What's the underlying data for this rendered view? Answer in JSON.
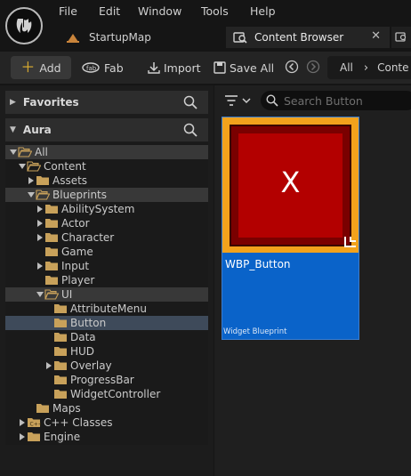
{
  "menu": [
    "File",
    "Edit",
    "Window",
    "Tools",
    "Help"
  ],
  "tabs": {
    "map": "StartupMap",
    "browser": "Content Browser"
  },
  "toolbar": {
    "add": "Add",
    "fab": "Fab",
    "import": "Import",
    "save_all": "Save All"
  },
  "breadcrumbs": {
    "first": "All",
    "second": "Conte"
  },
  "panels": {
    "favorites": "Favorites",
    "project": "Aura"
  },
  "tree": [
    {
      "label": "All",
      "indent": 0,
      "arrow": "down",
      "open": true,
      "state": "light"
    },
    {
      "label": "Content",
      "indent": 1,
      "arrow": "down",
      "open": true,
      "state": ""
    },
    {
      "label": "Assets",
      "indent": 2,
      "arrow": "right",
      "open": false,
      "state": ""
    },
    {
      "label": "Blueprints",
      "indent": 2,
      "arrow": "down",
      "open": true,
      "state": "light"
    },
    {
      "label": "AbilitySystem",
      "indent": 3,
      "arrow": "right",
      "open": false,
      "state": ""
    },
    {
      "label": "Actor",
      "indent": 3,
      "arrow": "right",
      "open": false,
      "state": ""
    },
    {
      "label": "Character",
      "indent": 3,
      "arrow": "right",
      "open": false,
      "state": ""
    },
    {
      "label": "Game",
      "indent": 3,
      "arrow": "",
      "open": false,
      "state": ""
    },
    {
      "label": "Input",
      "indent": 3,
      "arrow": "right",
      "open": false,
      "state": ""
    },
    {
      "label": "Player",
      "indent": 3,
      "arrow": "",
      "open": false,
      "state": ""
    },
    {
      "label": "UI",
      "indent": 3,
      "arrow": "down",
      "open": true,
      "state": "light"
    },
    {
      "label": "AttributeMenu",
      "indent": 4,
      "arrow": "",
      "open": false,
      "state": ""
    },
    {
      "label": "Button",
      "indent": 4,
      "arrow": "",
      "open": false,
      "state": "sel"
    },
    {
      "label": "Data",
      "indent": 4,
      "arrow": "",
      "open": false,
      "state": ""
    },
    {
      "label": "HUD",
      "indent": 4,
      "arrow": "",
      "open": false,
      "state": ""
    },
    {
      "label": "Overlay",
      "indent": 4,
      "arrow": "right",
      "open": false,
      "state": ""
    },
    {
      "label": "ProgressBar",
      "indent": 4,
      "arrow": "",
      "open": false,
      "state": ""
    },
    {
      "label": "WidgetController",
      "indent": 4,
      "arrow": "",
      "open": false,
      "state": ""
    },
    {
      "label": "Maps",
      "indent": 2,
      "arrow": "",
      "open": false,
      "state": ""
    },
    {
      "label": "C++ Classes",
      "indent": 1,
      "arrow": "right",
      "open": false,
      "state": "",
      "cpp": true
    },
    {
      "label": "Engine",
      "indent": 1,
      "arrow": "right",
      "open": false,
      "state": ""
    }
  ],
  "search": {
    "placeholder": "Search Button"
  },
  "asset": {
    "name": "WBP_Button",
    "type": "Widget Blueprint",
    "glyph": "X"
  },
  "colors": {
    "folder": "#c8a15a",
    "accent": "#0a63c9",
    "thumb_border": "#f2a21c",
    "thumb_fill": "#b30000"
  }
}
